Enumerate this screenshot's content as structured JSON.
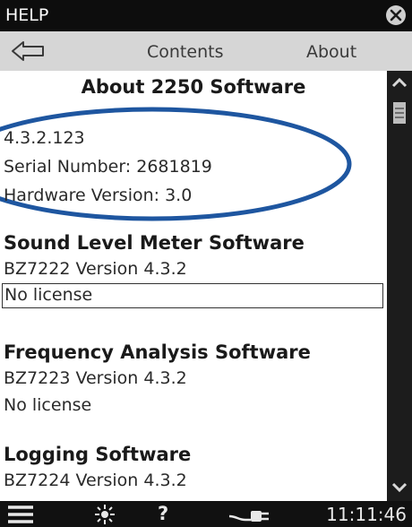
{
  "window": {
    "title": "HELP"
  },
  "nav": {
    "contents_label": "Contents",
    "about_label": "About"
  },
  "page": {
    "heading": "About 2250 Software",
    "version": "4.3.2.123",
    "serial": "Serial Number: 2681819",
    "hardware": "Hardware Version: 3.0",
    "sections": [
      {
        "title": "Sound Level Meter Software",
        "version": "BZ7222 Version 4.3.2",
        "license": "No license"
      },
      {
        "title": "Frequency Analysis Software",
        "version": "BZ7223 Version 4.3.2",
        "license": "No license"
      },
      {
        "title": "Logging Software",
        "version": "BZ7224 Version 4.3.2"
      }
    ]
  },
  "status": {
    "time": "11:11:46"
  },
  "colors": {
    "annotation_ellipse": "#1e56a0",
    "title_bar": "#0d0d0d",
    "nav_bar": "#d6d6d6"
  },
  "icons": [
    "close-icon",
    "back-arrow-icon",
    "scroll-up-icon",
    "scroll-thumb",
    "scroll-down-icon",
    "menu-icon",
    "sun-icon",
    "help-icon",
    "power-plug-icon"
  ]
}
